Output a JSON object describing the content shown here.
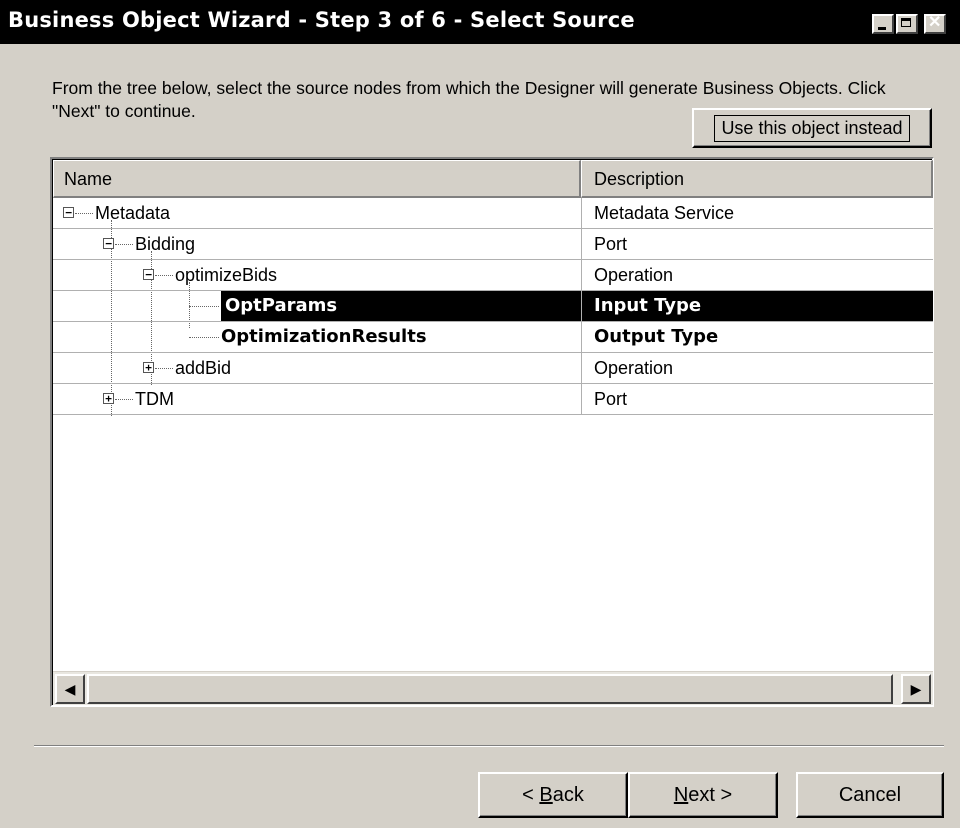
{
  "window": {
    "title": "Business Object Wizard - Step 3 of 6 - Select Source",
    "controls": {
      "minimize_icon": "minimize-icon",
      "maximize_icon": "maximize-icon",
      "close_icon": "close-icon",
      "close_glyph": "✕"
    }
  },
  "instructions": "From the tree below, select the source nodes from which the Designer will generate Business Objects. Click \"Next\" to continue.",
  "use_object_button": "Use this object instead",
  "tree": {
    "columns": {
      "name": "Name",
      "description": "Description"
    },
    "rows": [
      {
        "name": "Metadata",
        "description": "Metadata Service",
        "expander": "⊟",
        "level": 0,
        "bold": false,
        "selected": false
      },
      {
        "name": "Bidding",
        "description": "Port",
        "expander": "⊟",
        "level": 1,
        "bold": false,
        "selected": false
      },
      {
        "name": "optimizeBids",
        "description": "Operation",
        "expander": "⊟",
        "level": 2,
        "bold": false,
        "selected": false
      },
      {
        "name": "OptParams",
        "description": "Input Type",
        "expander": "",
        "level": 3,
        "bold": true,
        "selected": true
      },
      {
        "name": "OptimizationResults",
        "description": "Output Type",
        "expander": "",
        "level": 3,
        "bold": true,
        "selected": false
      },
      {
        "name": "addBid",
        "description": "Operation",
        "expander": "⊞",
        "level": 2,
        "bold": false,
        "selected": false
      },
      {
        "name": "TDM",
        "description": "Port",
        "expander": "⊞",
        "level": 1,
        "bold": false,
        "selected": false
      }
    ],
    "toggle_glyphs": {
      "minus": "−",
      "plus": "+"
    }
  },
  "scrollbar": {
    "left_arrow": "◀",
    "right_arrow": "▶"
  },
  "buttons": {
    "back_prefix": "< ",
    "back_accel": "B",
    "back_rest": "ack",
    "next_accel": "N",
    "next_rest": "ext >",
    "cancel": "Cancel"
  }
}
